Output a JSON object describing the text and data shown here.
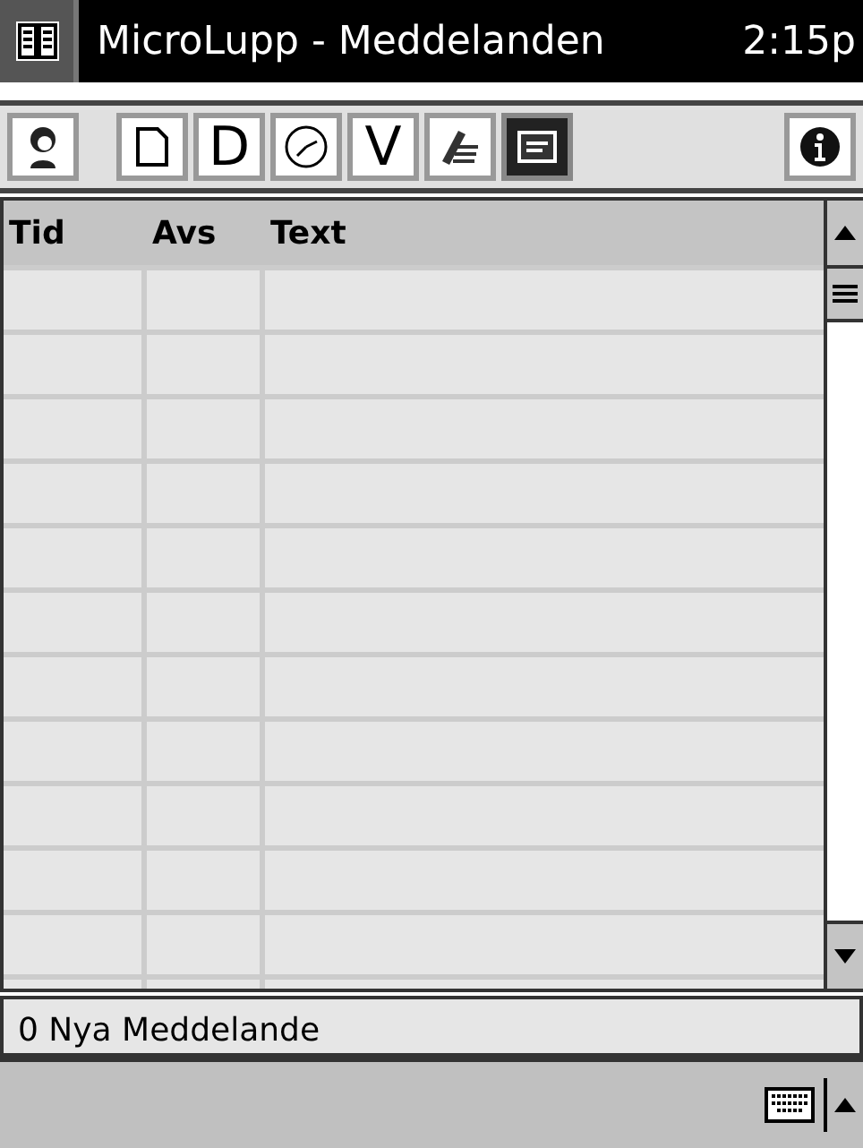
{
  "title_bar": {
    "title": "MicroLupp - Meddelanden",
    "time": "2:15p"
  },
  "toolbar": [
    {
      "kind": "person",
      "selected": false
    },
    {
      "kind": "page",
      "selected": false
    },
    {
      "kind": "letter",
      "label": "D",
      "selected": false
    },
    {
      "kind": "clock",
      "selected": false
    },
    {
      "kind": "letter",
      "label": "V",
      "selected": false
    },
    {
      "kind": "writing",
      "selected": false
    },
    {
      "kind": "message",
      "selected": true
    },
    {
      "kind": "info",
      "selected": false
    }
  ],
  "table": {
    "columns": [
      "Tid",
      "Avs",
      "Text"
    ]
  },
  "status_bar": "0 Nya Meddelande"
}
